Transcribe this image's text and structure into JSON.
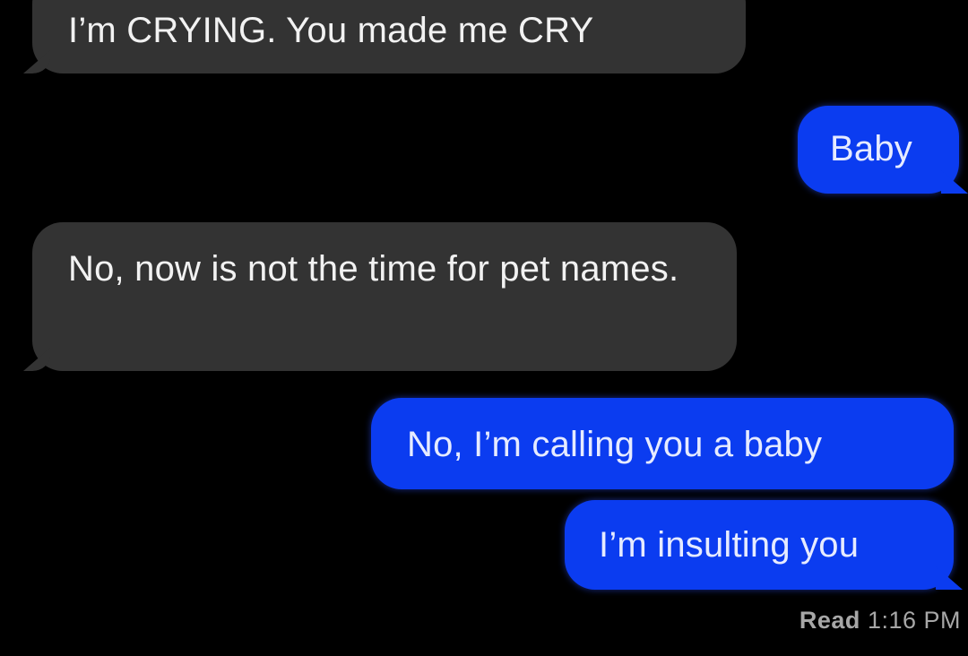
{
  "conversation": {
    "messages": [
      {
        "direction": "incoming",
        "text": "I’m CRYING. You made me CRY"
      },
      {
        "direction": "outgoing",
        "text": "Baby"
      },
      {
        "direction": "incoming",
        "text": "No, now is not the time for pet names."
      },
      {
        "direction": "outgoing",
        "text": "No, I’m calling you a baby"
      },
      {
        "direction": "outgoing",
        "text": "I’m insulting you"
      }
    ],
    "read_receipt": {
      "label": "Read",
      "time": "1:16 PM"
    }
  },
  "colors": {
    "background": "#000000",
    "incoming_bubble": "#333333",
    "outgoing_bubble": "#0b3cf0",
    "receipt_text": "#a7a7a7"
  }
}
